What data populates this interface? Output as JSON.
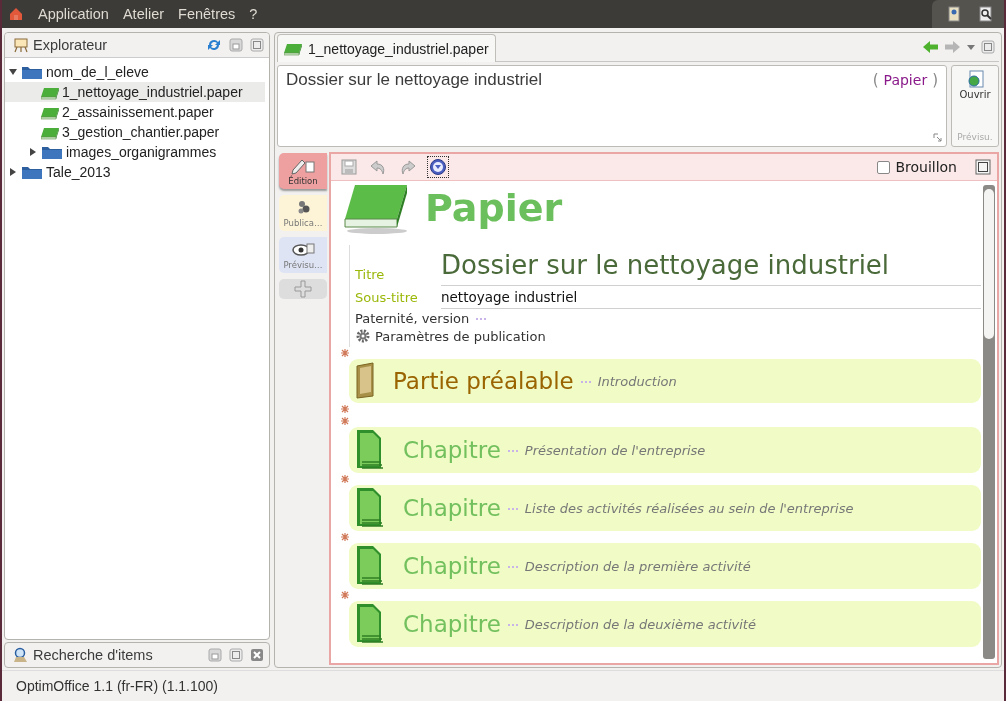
{
  "menu": [
    {
      "label": "Application"
    },
    {
      "label": "Atelier"
    },
    {
      "label": "Fenêtres"
    },
    {
      "label": "?"
    }
  ],
  "explorer": {
    "title": "Explorateur",
    "tree": [
      {
        "label": "nom_de_l_eleve",
        "kind": "folder",
        "expanded": true,
        "selected": false,
        "children": [
          {
            "label": "1_nettoyage_industriel.paper",
            "kind": "paper",
            "selected": true
          },
          {
            "label": "2_assainissement.paper",
            "kind": "paper",
            "selected": false
          },
          {
            "label": "3_gestion_chantier.paper",
            "kind": "paper",
            "selected": false
          },
          {
            "label": "images_organigrammes",
            "kind": "folder",
            "expanded": false,
            "selected": false
          }
        ]
      },
      {
        "label": "Tale_2013",
        "kind": "folder",
        "expanded": false,
        "selected": false
      }
    ]
  },
  "search_panel": {
    "title": "Recherche d'items"
  },
  "document_tab": {
    "label": "1_nettoyage_industriel.paper"
  },
  "header": {
    "title": "Dossier sur le nettoyage industriel",
    "paren_open": "(",
    "type": "Papier",
    "paren_close": ")"
  },
  "preview_panel": {
    "button": "Ouvrir",
    "label": "Prévisu."
  },
  "side_tabs": [
    {
      "label": "Édition",
      "kind": "edit",
      "selected": true
    },
    {
      "label": "Publica…",
      "kind": "publish",
      "selected": false
    },
    {
      "label": "Prévisu…",
      "kind": "preview",
      "selected": false
    }
  ],
  "draft": {
    "label": "Brouillon",
    "checked": false
  },
  "document": {
    "heading": "Papier",
    "fields": [
      {
        "label": "Titre",
        "value": "Dossier sur le nettoyage industriel",
        "kind": "title"
      },
      {
        "label": "Sous-titre",
        "value": "nettoyage industriel",
        "kind": "subtitle"
      }
    ],
    "authorship": "Paternité, version",
    "settings": "Paramètres de publication",
    "sections": [
      {
        "kind": "preliminary",
        "title": "Partie préalable",
        "subtitle": "Introduction"
      },
      {
        "kind": "chapter",
        "title": "Chapitre",
        "subtitle": "Présentation de l'entreprise"
      },
      {
        "kind": "chapter",
        "title": "Chapitre",
        "subtitle": "Liste des activités réalisées au sein de l'entreprise"
      },
      {
        "kind": "chapter",
        "title": "Chapitre",
        "subtitle": "Description de la première activité"
      },
      {
        "kind": "chapter",
        "title": "Chapitre",
        "subtitle": "Description de la deuxième activité"
      }
    ]
  },
  "status_bar": "OptimOffice 1.1 (fr-FR) (1.1.100)"
}
